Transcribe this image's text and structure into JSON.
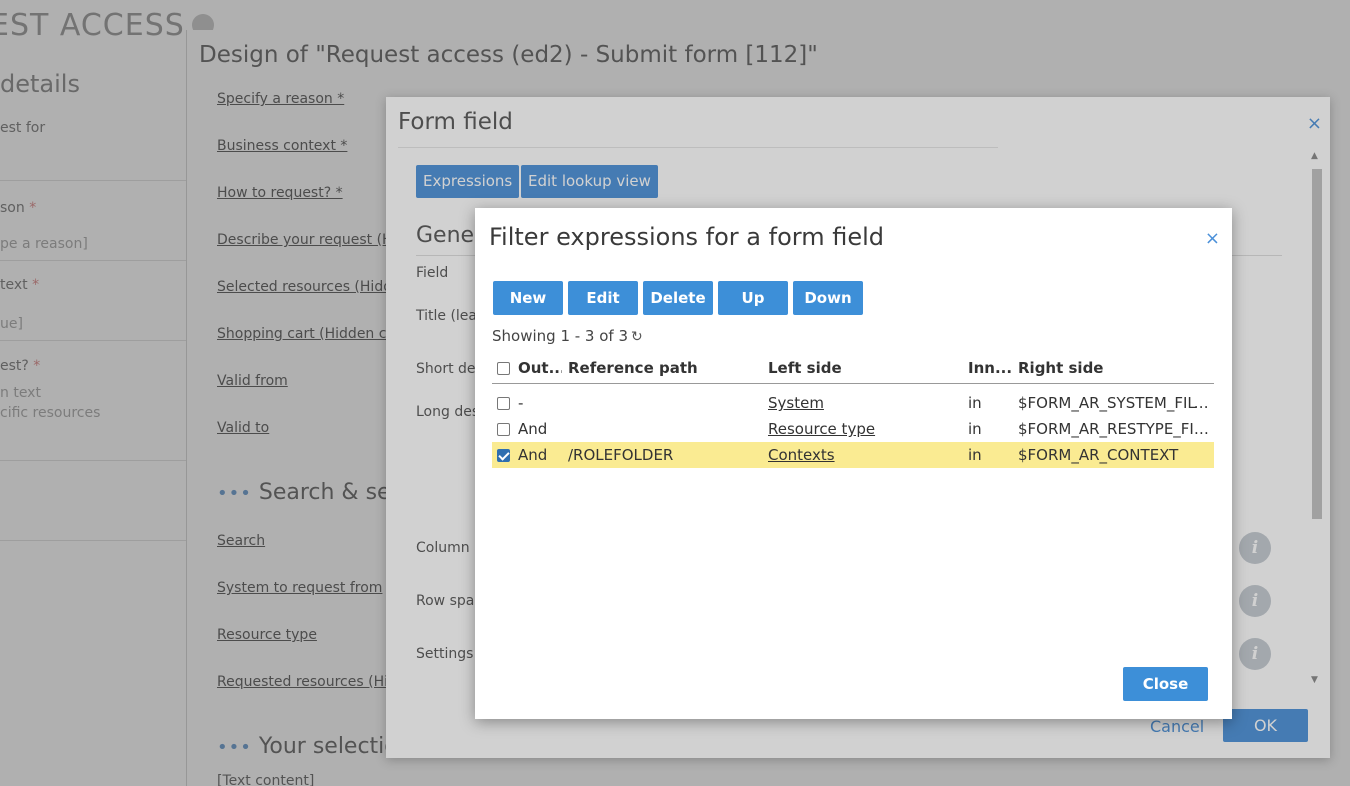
{
  "background_page": {
    "title": "EST ACCESS",
    "left_column": {
      "details_heading": "details",
      "request_for_label": "est for",
      "reason_label": "son",
      "reason_placeholder": "pe a reason]",
      "context_label": "text",
      "context_value": "ue]",
      "how_label": "est?",
      "how_option1": "n text",
      "how_option2": "cific resources",
      "required_mark": "*"
    },
    "design_panel": {
      "title": "Design of \"Request access (ed2) - Submit form [112]\"",
      "fields": [
        "Specify a reason *",
        "Business context *",
        "How to request? *",
        "Describe your request (H",
        "Selected resources (Hidd",
        "Shopping cart (Hidden cl",
        "Valid from",
        "Valid to"
      ],
      "section_search": "Search & sel",
      "section_dots": "•••",
      "search_fields": [
        "Search",
        "System to request from",
        "Resource type",
        "Requested resources (Hi"
      ],
      "section_selection": "Your selectio",
      "text_content": "[Text content]"
    }
  },
  "form_field_modal": {
    "title": "Form field",
    "close_glyph": "×",
    "buttons": {
      "expressions": "Expressions",
      "edit_lookup_view": "Edit lookup view"
    },
    "general_heading": "Gene",
    "labels": {
      "field": "Field",
      "title": "Title (lea",
      "short_desc": "Short de",
      "long_desc": "Long des",
      "column": "Column",
      "row_span": "Row spa",
      "settings": "Settings"
    },
    "info_glyph": "i",
    "cancel_label": "Cancel",
    "ok_label": "OK"
  },
  "filter_dialog": {
    "title": "Filter expressions for a form field",
    "close_glyph": "×",
    "toolbar": {
      "new": "New",
      "edit": "Edit",
      "delete": "Delete",
      "up": "Up",
      "down": "Down"
    },
    "showing": "Showing 1 - 3 of 3",
    "refresh_glyph": "↻",
    "columns": {
      "outer": "Out...",
      "reference_path": "Reference path",
      "left_side": "Left side",
      "inner": "Inn...",
      "right_side": "Right side"
    },
    "rows": [
      {
        "checked": false,
        "outer": "-",
        "reference_path": "",
        "left_side": "System",
        "inner": "in",
        "right_side": "$FORM_AR_SYSTEM_FILTER",
        "selected": false
      },
      {
        "checked": false,
        "outer": "And",
        "reference_path": "",
        "left_side": "Resource type",
        "inner": "in",
        "right_side": "$FORM_AR_RESTYPE_FILT...",
        "selected": false
      },
      {
        "checked": true,
        "outer": "And",
        "reference_path": "/ROLEFOLDER",
        "left_side": "Contexts",
        "inner": "in",
        "right_side": "$FORM_AR_CONTEXT",
        "selected": true
      }
    ],
    "close_label": "Close"
  },
  "colors": {
    "accent": "#3d8fd8",
    "selected_row": "#faeb92"
  }
}
